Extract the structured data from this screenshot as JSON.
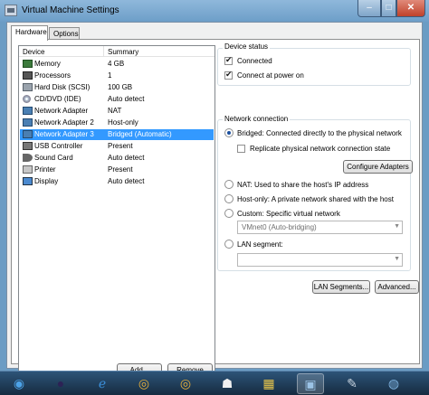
{
  "window": {
    "title": "Virtual Machine Settings"
  },
  "tabs": [
    {
      "label": "Hardware",
      "selected": true
    },
    {
      "label": "Options",
      "selected": false
    }
  ],
  "device_list": {
    "columns": [
      "Device",
      "Summary"
    ],
    "rows": [
      {
        "icon": "memory-icon",
        "device": "Memory",
        "summary": "4 GB"
      },
      {
        "icon": "processor-icon",
        "device": "Processors",
        "summary": "1"
      },
      {
        "icon": "hard-disk-icon",
        "device": "Hard Disk (SCSI)",
        "summary": "100 GB"
      },
      {
        "icon": "cd-dvd-icon",
        "device": "CD/DVD (IDE)",
        "summary": "Auto detect"
      },
      {
        "icon": "network-adapter-icon",
        "device": "Network Adapter",
        "summary": "NAT"
      },
      {
        "icon": "network-adapter-icon",
        "device": "Network Adapter 2",
        "summary": "Host-only"
      },
      {
        "icon": "network-adapter-icon",
        "device": "Network Adapter 3",
        "summary": "Bridged (Automatic)",
        "selected": true
      },
      {
        "icon": "usb-controller-icon",
        "device": "USB Controller",
        "summary": "Present"
      },
      {
        "icon": "sound-card-icon",
        "device": "Sound Card",
        "summary": "Auto detect"
      },
      {
        "icon": "printer-icon",
        "device": "Printer",
        "summary": "Present"
      },
      {
        "icon": "display-icon",
        "device": "Display",
        "summary": "Auto detect"
      }
    ],
    "add_label": "Add...",
    "remove_label": "Remove"
  },
  "device_status": {
    "title": "Device status",
    "connected_label": "Connected",
    "connected_checked": true,
    "connect_power_on_label": "Connect at power on",
    "connect_power_on_checked": true
  },
  "network_connection": {
    "title": "Network connection",
    "bridged_label": "Bridged: Connected directly to the physical network",
    "bridged_selected": true,
    "replicate_label": "Replicate physical network connection state",
    "replicate_checked": false,
    "configure_adapters_label": "Configure Adapters",
    "nat_label": "NAT: Used to share the host's IP address",
    "host_only_label": "Host-only: A private network shared with the host",
    "custom_label": "Custom: Specific virtual network",
    "vmnet_value": "VMnet0 (Auto-bridging)",
    "lan_segment_label": "LAN segment:",
    "lan_segment_value": "",
    "lan_segments_button": "LAN Segments...",
    "advanced_button": "Advanced..."
  },
  "taskbar": {
    "items": [
      {
        "icon": "start-orb-icon",
        "glyph": "◉"
      },
      {
        "icon": "eclipse-icon",
        "glyph": "●"
      },
      {
        "icon": "internet-explorer-icon",
        "glyph": "ℯ"
      },
      {
        "icon": "chrome-icon",
        "glyph": "◎"
      },
      {
        "icon": "chrome-icon",
        "glyph": "◎"
      },
      {
        "icon": "reader-icon",
        "glyph": "☗"
      },
      {
        "icon": "folder-app-icon",
        "glyph": "▦"
      },
      {
        "icon": "vmware-icon",
        "glyph": "▣"
      },
      {
        "icon": "tool-icon",
        "glyph": "✎"
      },
      {
        "icon": "app-icon",
        "glyph": "◍"
      }
    ]
  }
}
